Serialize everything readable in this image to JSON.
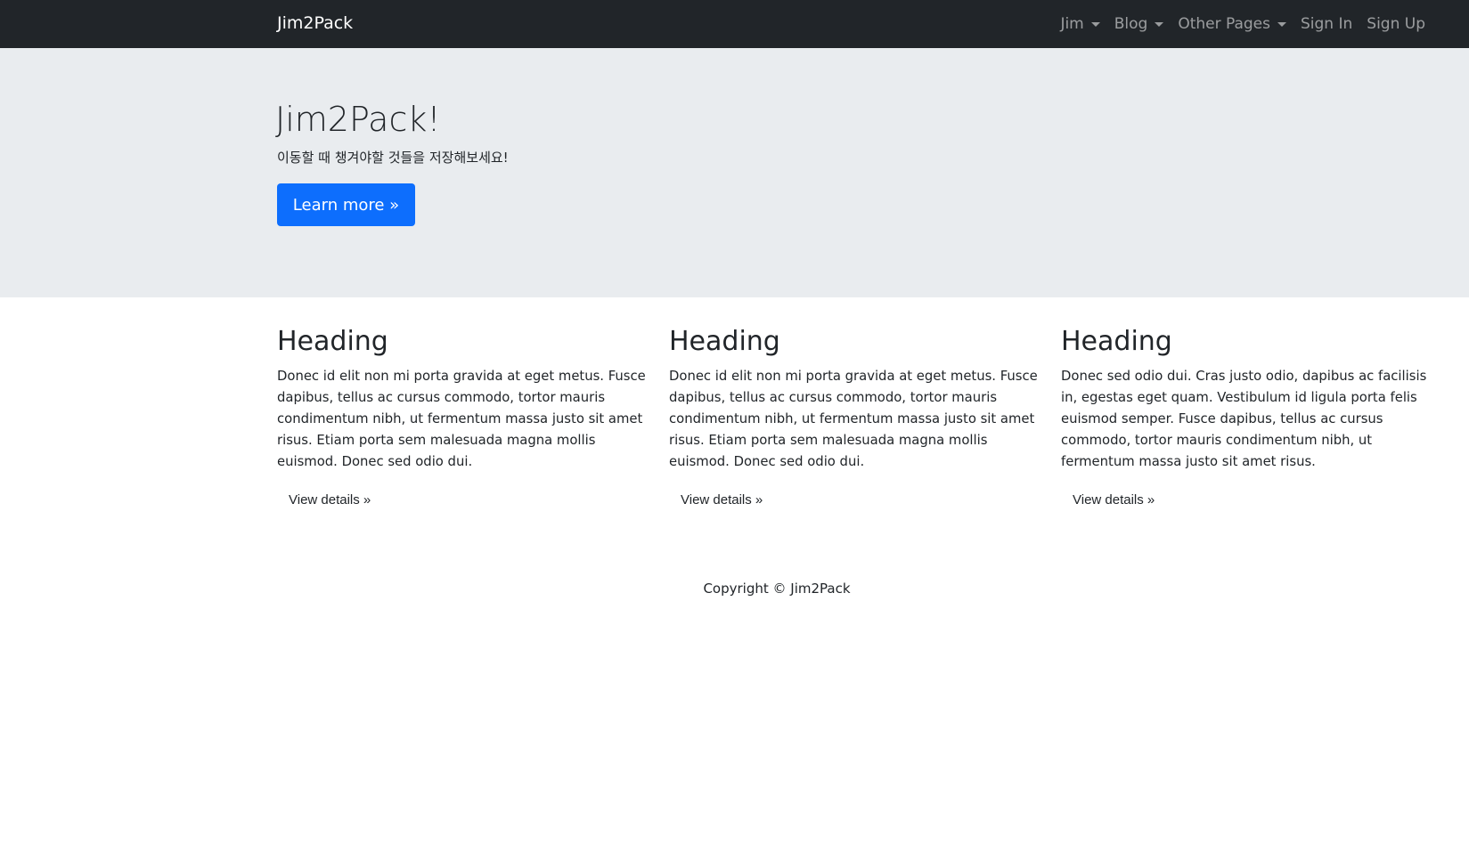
{
  "navbar": {
    "brand": "Jim2Pack",
    "items": [
      {
        "label": "Jim",
        "dropdown": true
      },
      {
        "label": "Blog",
        "dropdown": true
      },
      {
        "label": "Other Pages",
        "dropdown": true
      },
      {
        "label": "Sign In",
        "dropdown": false
      },
      {
        "label": "Sign Up",
        "dropdown": false
      }
    ]
  },
  "jumbotron": {
    "title": "Jim2Pack!",
    "subtitle": "이동할 때 챙겨야할 것들을 저장해보세요!",
    "button_label": "Learn more »",
    "button_color": "#0d6efd"
  },
  "columns": [
    {
      "heading": "Heading",
      "text": "Donec id elit non mi porta gravida at eget metus. Fusce dapibus, tellus ac cursus commodo, tortor mauris condimentum nibh, ut fermentum massa justo sit amet risus. Etiam porta sem malesuada magna mollis euismod. Donec sed odio dui.",
      "button_label": "View details »"
    },
    {
      "heading": "Heading",
      "text": "Donec id elit non mi porta gravida at eget metus. Fusce dapibus, tellus ac cursus commodo, tortor mauris condimentum nibh, ut fermentum massa justo sit amet risus. Etiam porta sem malesuada magna mollis euismod. Donec sed odio dui.",
      "button_label": "View details »"
    },
    {
      "heading": "Heading",
      "text": "Donec sed odio dui. Cras justo odio, dapibus ac facilisis in, egestas eget quam. Vestibulum id ligula porta felis euismod semper. Fusce dapibus, tellus ac cursus commodo, tortor mauris condimentum nibh, ut fermentum massa justo sit amet risus.",
      "button_label": "View details »"
    }
  ],
  "footer": {
    "text": "Copyright © Jim2Pack"
  },
  "colors": {
    "navbar_bg": "#212529",
    "jumbotron_bg": "#e9ecef",
    "primary": "#0d6efd"
  }
}
